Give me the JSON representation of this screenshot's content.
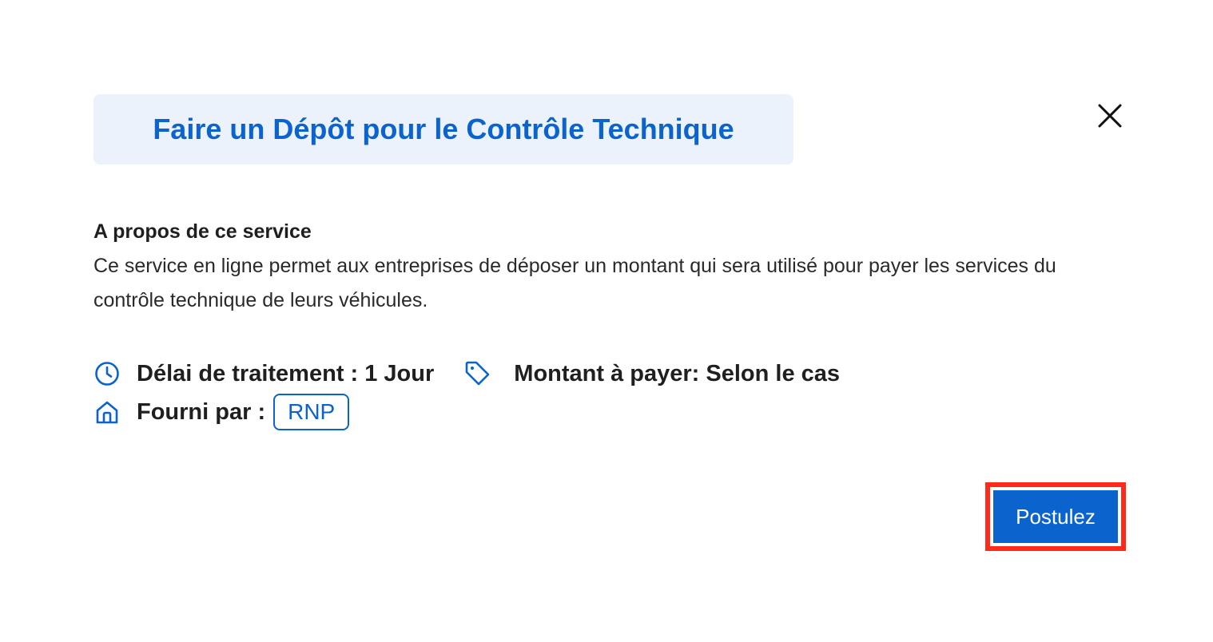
{
  "dialog": {
    "title": "Faire un Dépôt pour le Contrôle Technique",
    "close_icon": "close-icon"
  },
  "about": {
    "heading": "A propos de ce service",
    "description": "Ce service en ligne permet aux entreprises de déposer un montant qui sera utilisé pour payer les services du contrôle technique de leurs véhicules."
  },
  "details": {
    "processing_time": {
      "icon": "clock-icon",
      "label": "Délai de traitement : 1 Jour"
    },
    "amount": {
      "icon": "tag-icon",
      "label": "Montant à payer: Selon le cas"
    },
    "provider": {
      "icon": "home-icon",
      "label": "Fourni par :",
      "value": "RNP"
    }
  },
  "actions": {
    "apply_label": "Postulez"
  },
  "colors": {
    "primary": "#0b63ce",
    "title_background": "#ebf2fc",
    "highlight_outline": "#ff2a1a",
    "text": "#1f1f1f"
  }
}
